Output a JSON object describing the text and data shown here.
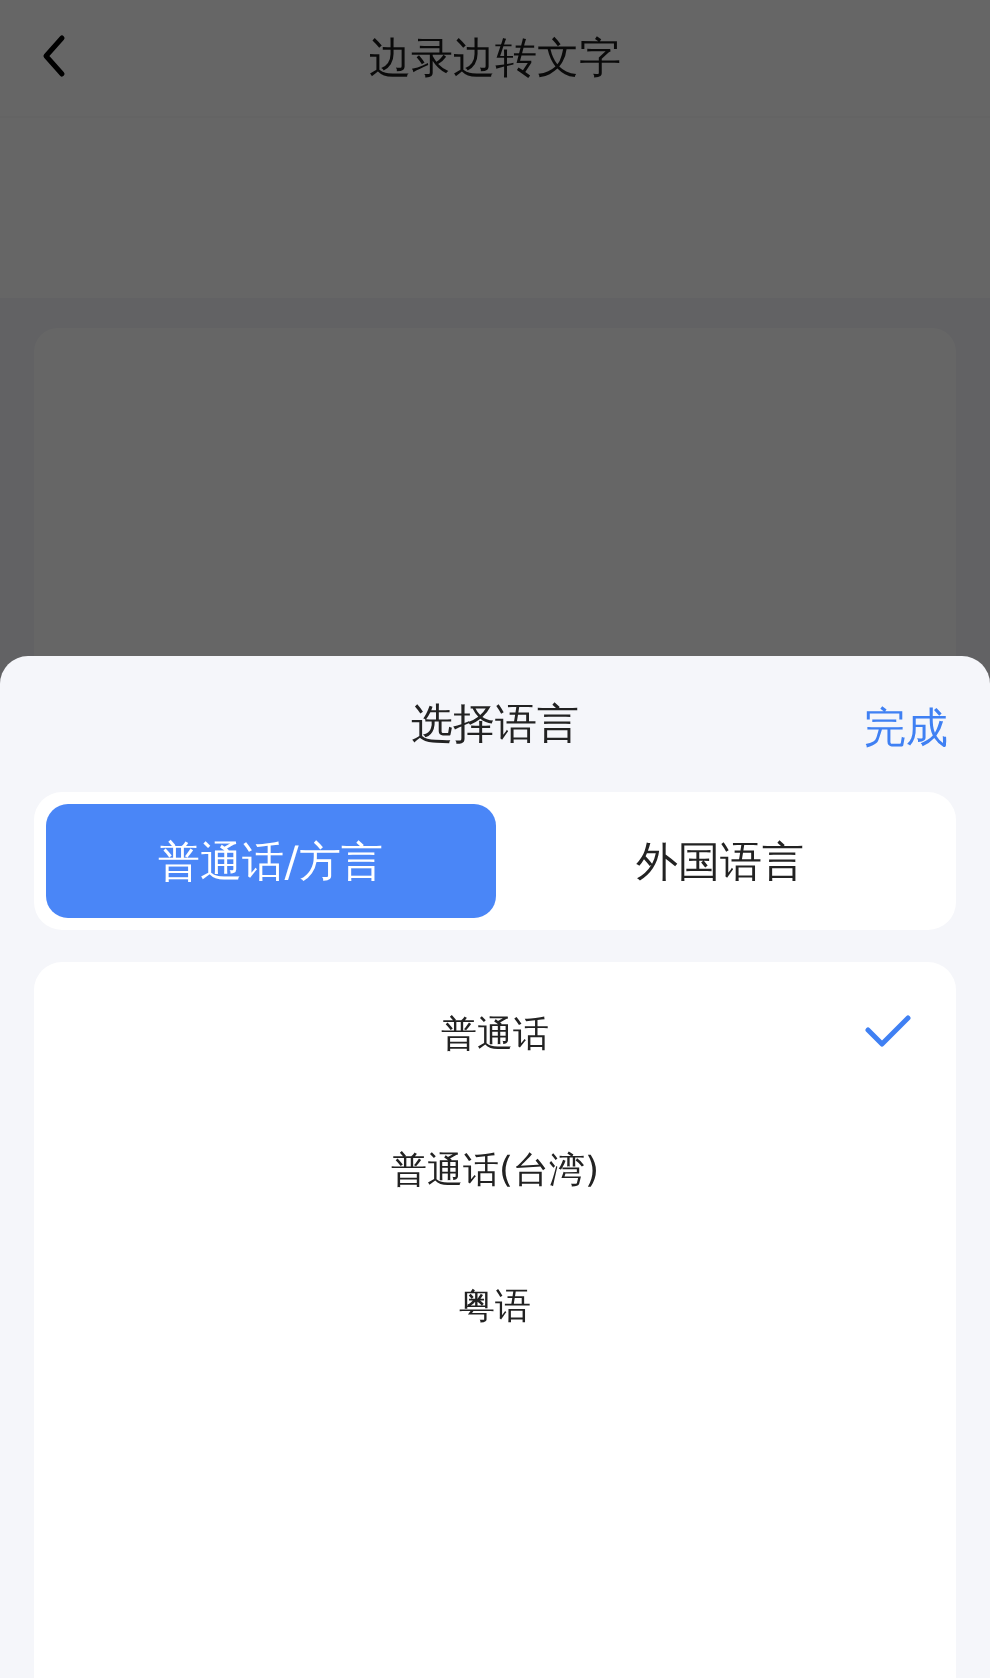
{
  "header": {
    "title": "边录边转文字"
  },
  "sheet": {
    "title": "选择语言",
    "done": "完成",
    "tabs": [
      {
        "label": "普通话/方言",
        "selected": true
      },
      {
        "label": "外国语言",
        "selected": false
      }
    ],
    "languages": [
      {
        "label": "普通话",
        "selected": true
      },
      {
        "label": "普通话(台湾)",
        "selected": false
      },
      {
        "label": "粤语",
        "selected": false
      }
    ]
  }
}
